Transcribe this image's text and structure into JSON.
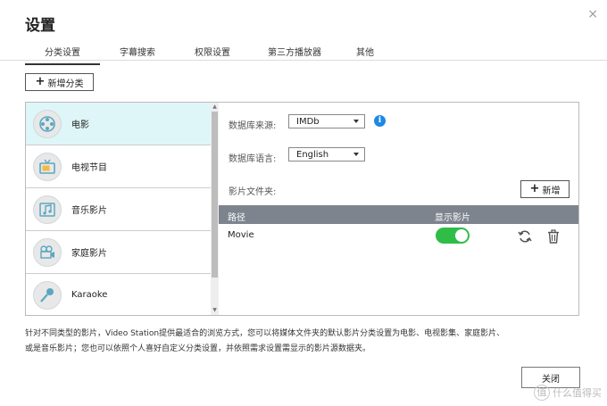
{
  "dialog": {
    "title": "设置",
    "close_glyph": "×"
  },
  "tabs": [
    "分类设置",
    "字幕搜索",
    "权限设置",
    "第三方播放器",
    "其他"
  ],
  "toolbar": {
    "add_category_label": "新增分类"
  },
  "categories": [
    {
      "label": "电影",
      "icon": "film-reel-icon",
      "selected": true
    },
    {
      "label": "电视节目",
      "icon": "tv-icon",
      "selected": false
    },
    {
      "label": "音乐影片",
      "icon": "music-icon",
      "selected": false
    },
    {
      "label": "家庭影片",
      "icon": "camcorder-icon",
      "selected": false
    },
    {
      "label": "Karaoke",
      "icon": "microphone-icon",
      "selected": false
    }
  ],
  "settings": {
    "db_source_label": "数据库来源:",
    "db_source_value": "IMDb",
    "db_language_label": "数据库语言:",
    "db_language_value": "English",
    "folder_label": "影片文件夹:",
    "add_label": "新增"
  },
  "table": {
    "headers": [
      "路径",
      "显示影片"
    ],
    "rows": [
      {
        "path": "Movie",
        "show": true
      }
    ]
  },
  "description": {
    "line1": "针对不同类型的影片，Video Station提供最适合的浏览方式，您可以将媒体文件夹的默认影片分类设置为电影、电视影集、家庭影片、",
    "line2": "或是音乐影片；您也可以依照个人喜好自定义分类设置，并依照需求设置需显示的影片源数据夹。"
  },
  "footer": {
    "close_label": "关闭"
  },
  "watermark": {
    "text": "什么值得买",
    "icon_glyph": "值"
  },
  "colors": {
    "selected_bg": "#dff6f8",
    "header_bg": "#7e848e",
    "toggle_on": "#2fbd48",
    "info_blue": "#1e88e5"
  }
}
